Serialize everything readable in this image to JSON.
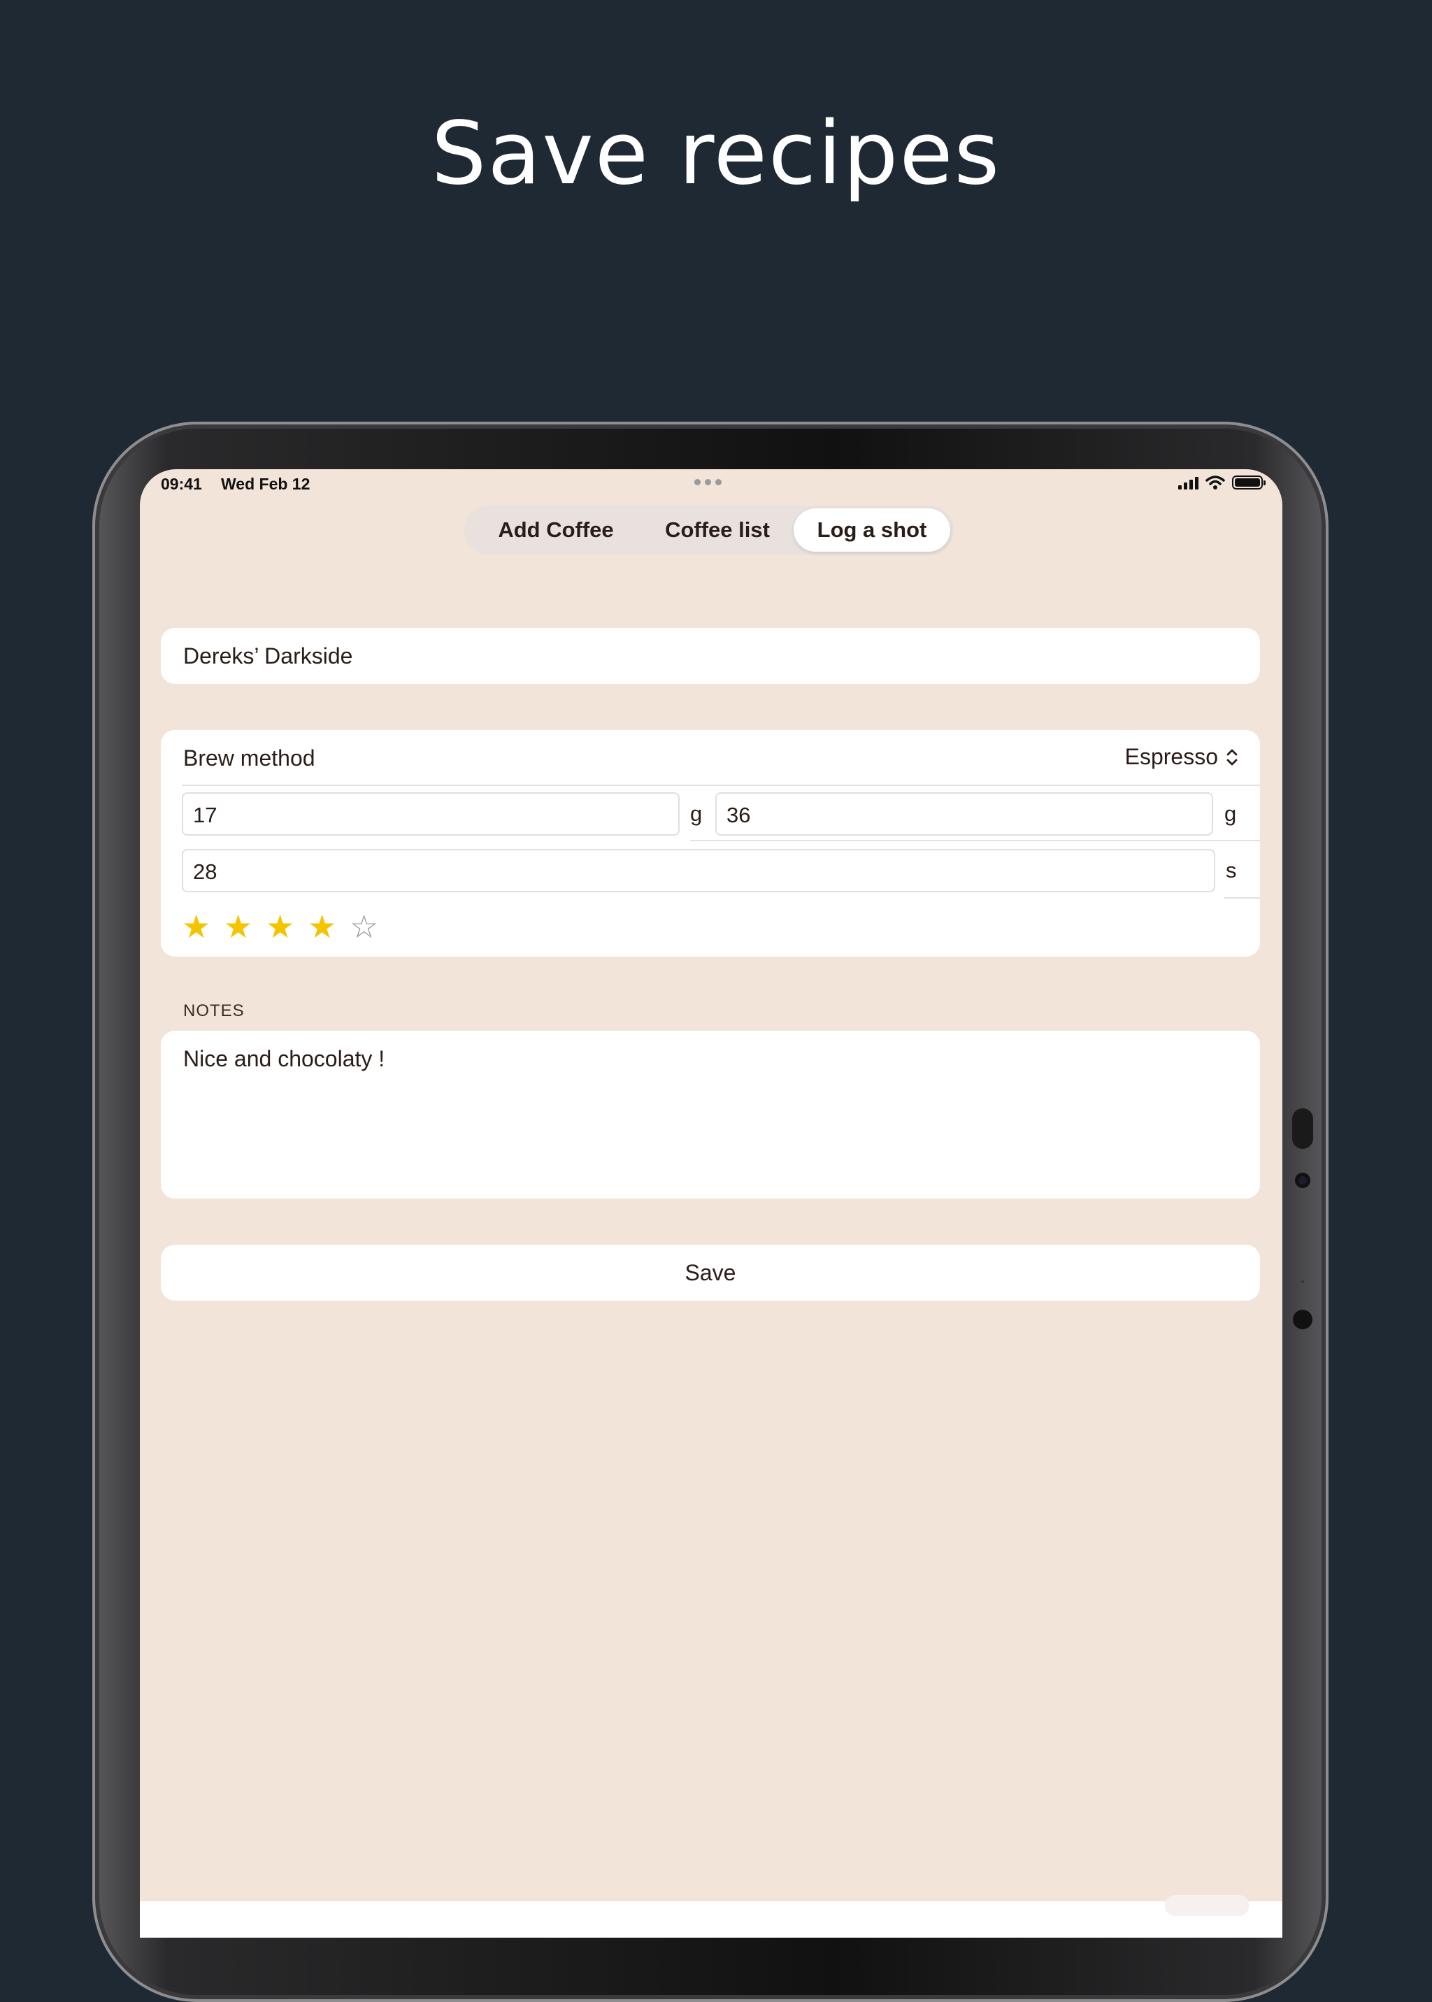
{
  "headline": "Save recipes",
  "status_bar": {
    "time": "09:41",
    "date": "Wed Feb 12"
  },
  "tabs": [
    {
      "label": "Add Coffee",
      "active": false
    },
    {
      "label": "Coffee list",
      "active": false
    },
    {
      "label": "Log a shot",
      "active": true
    }
  ],
  "form": {
    "coffee_name": "Dereks’ Darkside",
    "brew_method_label": "Brew method",
    "brew_method_value": "Espresso",
    "dose_value": "17",
    "dose_unit": "g",
    "yield_value": "36",
    "yield_unit": "g",
    "time_value": "28",
    "time_unit": "s",
    "rating": 4,
    "rating_max": 5,
    "notes_label": "NOTES",
    "notes_text": "Nice and chocolaty !",
    "save_label": "Save"
  },
  "colors": {
    "background": "#1f2933",
    "screen_background": "#f2e4d8",
    "star_filled": "#f5c400",
    "star_empty": "#9a9a9a",
    "text": "#2a1d17"
  },
  "icons": {
    "brew_method_picker": "chevron-up-down-icon",
    "rating_filled": "star-filled-icon",
    "rating_empty": "star-outline-icon"
  }
}
